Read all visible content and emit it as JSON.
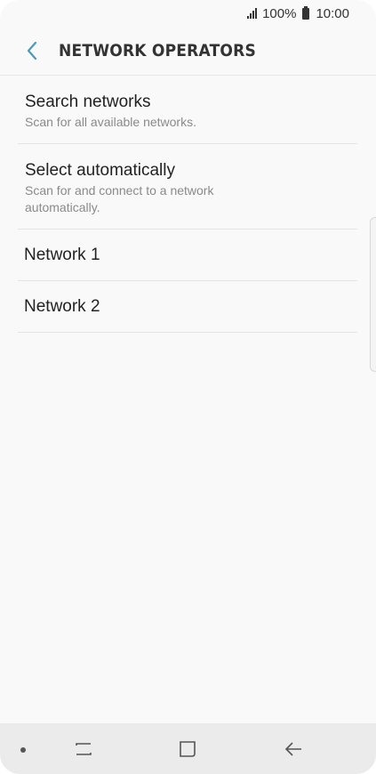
{
  "status_bar": {
    "battery": "100%",
    "time": "10:00"
  },
  "header": {
    "title": "NETWORK OPERATORS",
    "back_icon": "chevron-left-icon",
    "accent_color": "#4a9ab8"
  },
  "list": {
    "search": {
      "title": "Search networks",
      "subtitle": "Scan for all available networks."
    },
    "auto": {
      "title": "Select automatically",
      "subtitle": "Scan for and connect to a network automatically."
    },
    "networks": [
      "Network 1",
      "Network 2"
    ]
  },
  "nav_bar": {
    "icons": [
      "recent-apps-icon",
      "home-icon",
      "back-arrow-icon"
    ]
  }
}
